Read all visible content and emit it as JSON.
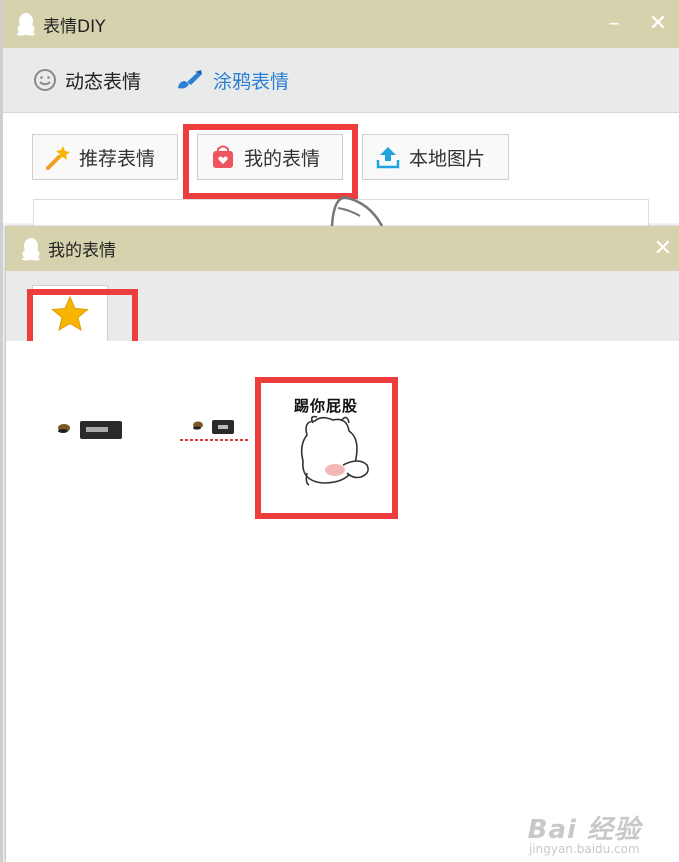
{
  "outer_window": {
    "title": "表情DIY",
    "controls": {
      "minimize": "–",
      "close": "✕"
    },
    "mode_tabs": [
      {
        "label": "动态表情",
        "icon": "smiley-icon"
      },
      {
        "label": "涂鸦表情",
        "icon": "paint-brush-icon",
        "active": true
      }
    ],
    "buttons": {
      "recommended": "推荐表情",
      "mine": "我的表情",
      "local": "本地图片"
    }
  },
  "inner_window": {
    "title": "我的表情",
    "controls": {
      "close": "✕"
    },
    "tabs": [
      {
        "icon": "star-icon",
        "selected": true
      }
    ],
    "stickers": [
      {
        "name": "sticker-1",
        "caption": ""
      },
      {
        "name": "sticker-2",
        "caption": ""
      },
      {
        "name": "sticker-3",
        "caption": "踢你屁股"
      }
    ]
  },
  "watermark": {
    "main": "Bai 经验",
    "sub": "jingyan.baidu.com"
  },
  "colors": {
    "title_bar": "#d6d2ad",
    "highlight": "#ee3d3d",
    "active_tab_text": "#2b7fd4",
    "star": "#f7b500"
  }
}
